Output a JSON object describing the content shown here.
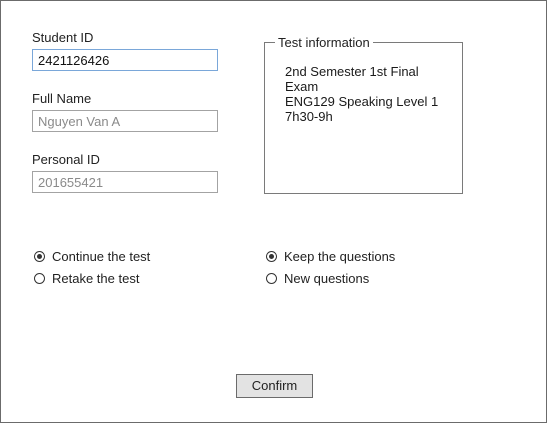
{
  "form": {
    "student_id": {
      "label": "Student ID",
      "value": "2421126426"
    },
    "full_name": {
      "label": "Full Name",
      "value": "Nguyen Van A"
    },
    "personal_id": {
      "label": "Personal ID",
      "value": "201655421"
    }
  },
  "test_info": {
    "legend": "Test information",
    "lines": [
      "2nd Semester 1st Final Exam",
      "ENG129 Speaking Level 1",
      "7h30-9h"
    ]
  },
  "options": {
    "mode": [
      {
        "label": "Continue the test",
        "checked": true
      },
      {
        "label": "Retake the test",
        "checked": false
      }
    ],
    "questions": [
      {
        "label": "Keep the questions",
        "checked": true
      },
      {
        "label": "New questions",
        "checked": false
      }
    ]
  },
  "actions": {
    "confirm_label": "Confirm"
  }
}
